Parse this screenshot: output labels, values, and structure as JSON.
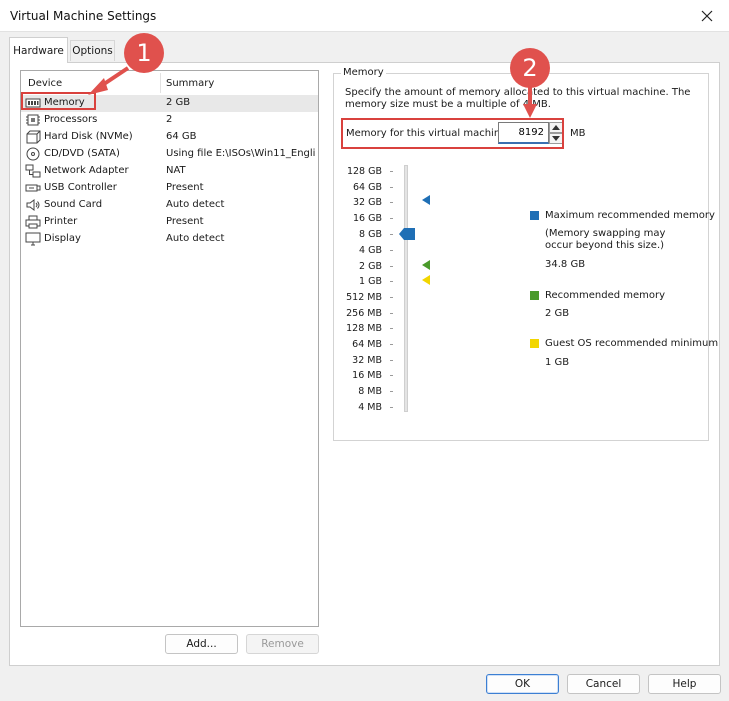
{
  "window": {
    "title": "Virtual Machine Settings"
  },
  "tabs": [
    {
      "label": "Hardware"
    },
    {
      "label": "Options"
    }
  ],
  "device_list": {
    "columns": {
      "device": "Device",
      "summary": "Summary"
    },
    "rows": [
      {
        "name": "Memory",
        "summary": "2 GB",
        "icon": "memory-icon"
      },
      {
        "name": "Processors",
        "summary": "2",
        "icon": "processor-icon"
      },
      {
        "name": "Hard Disk (NVMe)",
        "summary": "64 GB",
        "icon": "hard-disk-icon"
      },
      {
        "name": "CD/DVD (SATA)",
        "summary": "Using file E:\\ISOs\\Win11_Engli...",
        "icon": "cd-dvd-icon"
      },
      {
        "name": "Network Adapter",
        "summary": "NAT",
        "icon": "network-adapter-icon"
      },
      {
        "name": "USB Controller",
        "summary": "Present",
        "icon": "usb-icon"
      },
      {
        "name": "Sound Card",
        "summary": "Auto detect",
        "icon": "sound-card-icon"
      },
      {
        "name": "Printer",
        "summary": "Present",
        "icon": "printer-icon"
      },
      {
        "name": "Display",
        "summary": "Auto detect",
        "icon": "display-icon"
      }
    ]
  },
  "buttons": {
    "add": "Add...",
    "remove": "Remove",
    "ok": "OK",
    "cancel": "Cancel",
    "help": "Help"
  },
  "memory": {
    "group_title": "Memory",
    "description": "Specify the amount of memory allocated to this virtual machine. The memory size must be a multiple of 4 MB.",
    "field_label": "Memory for this virtual machine:",
    "value": "8192",
    "unit": "MB",
    "scale": [
      "128 GB",
      "64 GB",
      "32 GB",
      "16 GB",
      "8 GB",
      "4 GB",
      "2 GB",
      "1 GB",
      "512 MB",
      "256 MB",
      "128 MB",
      "64 MB",
      "32 MB",
      "16 MB",
      "8 MB",
      "4 MB"
    ],
    "legend": {
      "max": {
        "label": "Maximum recommended memory",
        "note": "(Memory swapping may occur beyond this size.)",
        "value": "34.8 GB",
        "color": "#1f6fb5"
      },
      "recommended": {
        "label": "Recommended memory",
        "value": "2 GB",
        "color": "#4a9a2a"
      },
      "guest_min": {
        "label": "Guest OS recommended minimum",
        "value": "1 GB",
        "color": "#f2d600"
      }
    }
  },
  "callouts": {
    "one": "1",
    "two": "2"
  },
  "colors": {
    "accent": "#1f6fb5",
    "annotation": "#e0514d"
  }
}
